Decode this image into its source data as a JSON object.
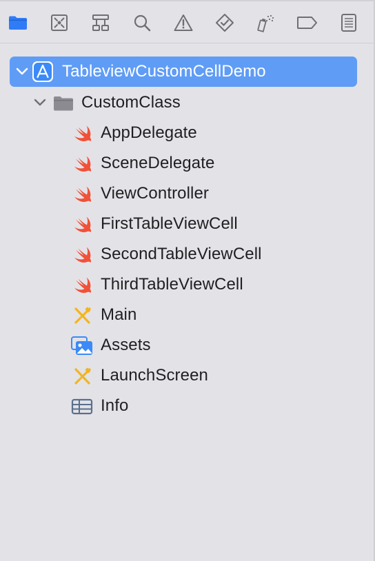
{
  "toolbar": {
    "buttons": [
      {
        "name": "project-navigator-icon",
        "active": true
      },
      {
        "name": "source-control-navigator-icon",
        "active": false
      },
      {
        "name": "symbol-navigator-icon",
        "active": false
      },
      {
        "name": "find-navigator-icon",
        "active": false
      },
      {
        "name": "issue-navigator-icon",
        "active": false
      },
      {
        "name": "test-navigator-icon",
        "active": false
      },
      {
        "name": "debug-navigator-icon",
        "active": false
      },
      {
        "name": "breakpoint-navigator-icon",
        "active": false
      },
      {
        "name": "report-navigator-icon",
        "active": false
      }
    ]
  },
  "tree": {
    "project": {
      "label": "TableviewCustomCellDemo",
      "icon": "xcode-project-icon",
      "expanded": true,
      "selected": true
    },
    "group": {
      "label": "CustomClass",
      "icon": "folder-icon",
      "expanded": true
    },
    "files": [
      {
        "label": "AppDelegate",
        "icon": "swift-file-icon"
      },
      {
        "label": "SceneDelegate",
        "icon": "swift-file-icon"
      },
      {
        "label": "ViewController",
        "icon": "swift-file-icon"
      },
      {
        "label": "FirstTableViewCell",
        "icon": "swift-file-icon"
      },
      {
        "label": "SecondTableViewCell",
        "icon": "swift-file-icon"
      },
      {
        "label": "ThirdTableViewCell",
        "icon": "swift-file-icon"
      },
      {
        "label": "Main",
        "icon": "storyboard-icon"
      },
      {
        "label": "Assets",
        "icon": "asset-catalog-icon"
      },
      {
        "label": "LaunchScreen",
        "icon": "storyboard-icon"
      },
      {
        "label": "Info",
        "icon": "plist-icon"
      }
    ]
  },
  "colors": {
    "background": "#e3e2e7",
    "selection": "#5f9cf6",
    "accent_blue": "#2f7cf6",
    "swift_orange": "#f05138",
    "storyboard_yellow": "#f2b51f",
    "toolbar_gray": "#6e6e73"
  }
}
